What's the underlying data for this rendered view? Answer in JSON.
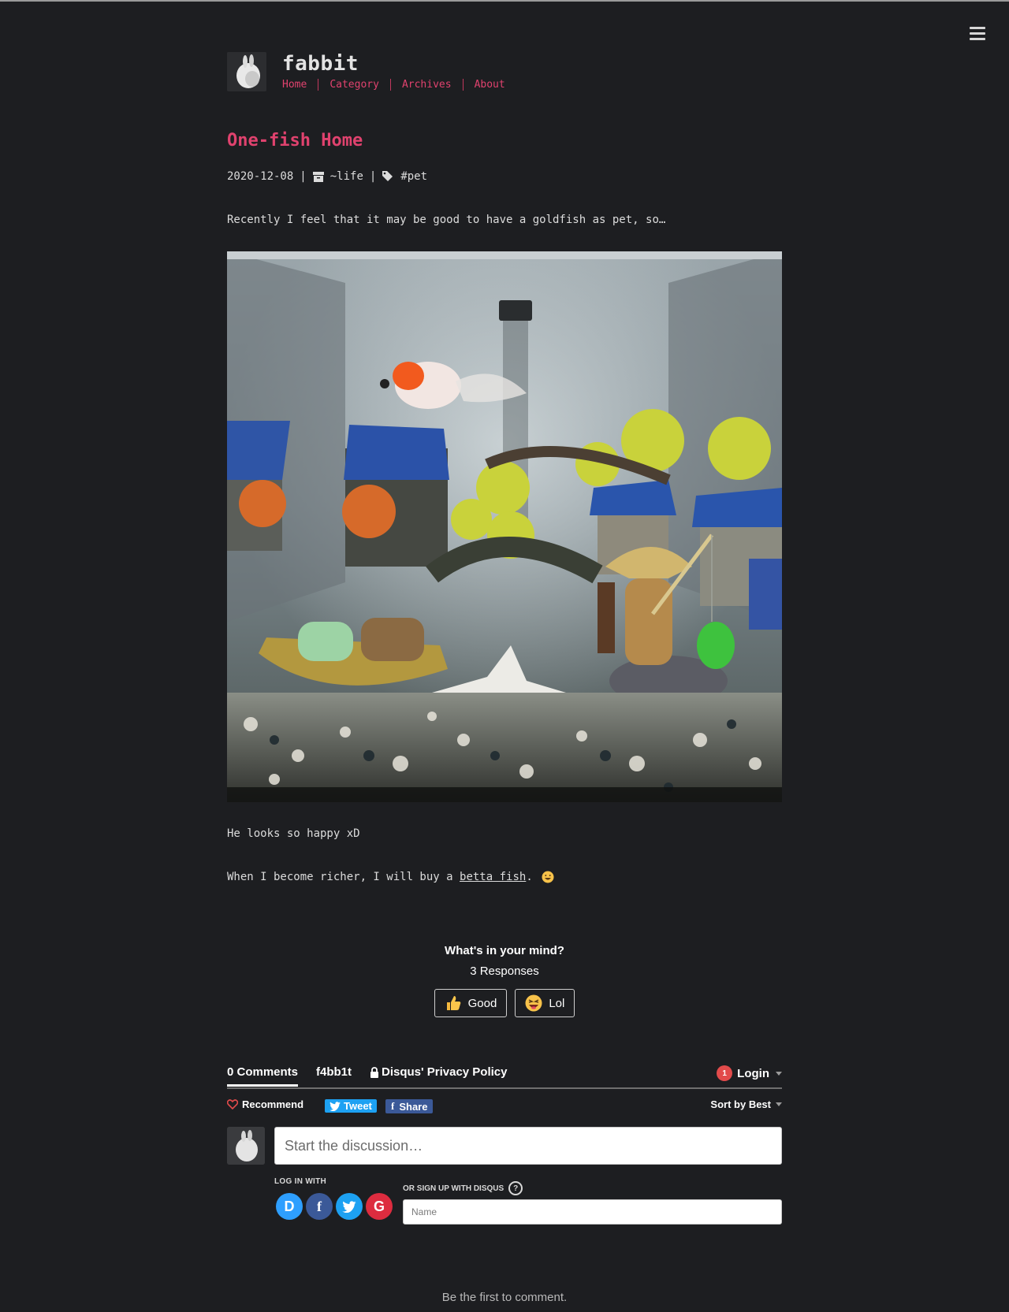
{
  "site": {
    "title": "fabbit",
    "nav": [
      "Home",
      "Category",
      "Archives",
      "About"
    ]
  },
  "post": {
    "title": "One-fish Home",
    "date": "2020-12-08",
    "category": "~life",
    "tag": "#pet",
    "intro": "Recently I feel that it may be good to have a goldfish as pet, so…",
    "caption": "He looks so happy xD",
    "closing_before": "When I become richer, I will buy a ",
    "closing_link": "betta fish",
    "closing_after": "."
  },
  "reactions": {
    "question": "What's in your mind?",
    "responses": "3 Responses",
    "buttons": [
      {
        "label": "Good",
        "icon": "thumbs-up-icon"
      },
      {
        "label": "Lol",
        "icon": "laughing-face-icon"
      }
    ]
  },
  "disqus": {
    "tabs": {
      "comments": "0 Comments",
      "forum": "f4bb1t",
      "privacy": "Disqus' Privacy Policy"
    },
    "login": {
      "label": "Login",
      "badge": "1"
    },
    "recommend": "Recommend",
    "tweet": "Tweet",
    "share": "Share",
    "sort": "Sort by Best",
    "compose_placeholder": "Start the discussion…",
    "log_in_with": "LOG IN WITH",
    "sign_up": "OR SIGN UP WITH DISQUS",
    "name_placeholder": "Name",
    "first_comment": "Be the first to comment.",
    "colors": {
      "twitter": "#1da1f2",
      "facebook": "#3b5998",
      "disqus": "#2e9fff",
      "google": "#dd2c3f",
      "badge": "#e24b4b"
    }
  },
  "colors": {
    "accent": "#e0426e",
    "background": "#1d1e21"
  }
}
